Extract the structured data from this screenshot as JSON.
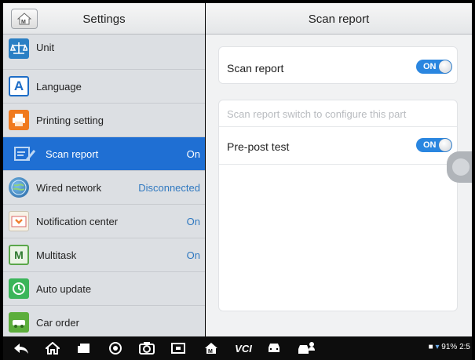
{
  "left_panel": {
    "title": "Settings",
    "items": [
      {
        "label": "Unit",
        "status": "",
        "icon": "scale-icon"
      },
      {
        "label": "Language",
        "status": "",
        "icon": "language-icon"
      },
      {
        "label": "Printing setting",
        "status": "",
        "icon": "printer-icon"
      },
      {
        "label": "Scan report",
        "status": "On",
        "icon": "scan-report-icon",
        "active": true
      },
      {
        "label": "Wired network",
        "status": "Disconnected",
        "icon": "globe-icon"
      },
      {
        "label": "Notification center",
        "status": "On",
        "icon": "notification-icon"
      },
      {
        "label": "Multitask",
        "status": "On",
        "icon": "multitask-icon"
      },
      {
        "label": "Auto update",
        "status": "",
        "icon": "clock-icon"
      },
      {
        "label": "Car order",
        "status": "",
        "icon": "car-order-icon"
      }
    ]
  },
  "right_panel": {
    "title": "Scan report",
    "scan_report_label": "Scan report",
    "scan_report_toggle": "ON",
    "hint": "Scan report switch to configure this part",
    "prepost_label": "Pre-post test",
    "prepost_toggle": "ON"
  },
  "navbar": {
    "icons": [
      "back-icon",
      "home-icon",
      "recent-apps-icon",
      "chrome-icon",
      "camera-icon",
      "screen-mirror-icon",
      "maxisys-home-icon",
      "vci-icon",
      "car-icon",
      "car-user-icon"
    ],
    "vci_label": "VCI",
    "status_text": "91% 2:5"
  },
  "colors": {
    "active": "#1f6fd3",
    "toggle": "#2a86e0",
    "status_blue": "#2f78c0"
  }
}
